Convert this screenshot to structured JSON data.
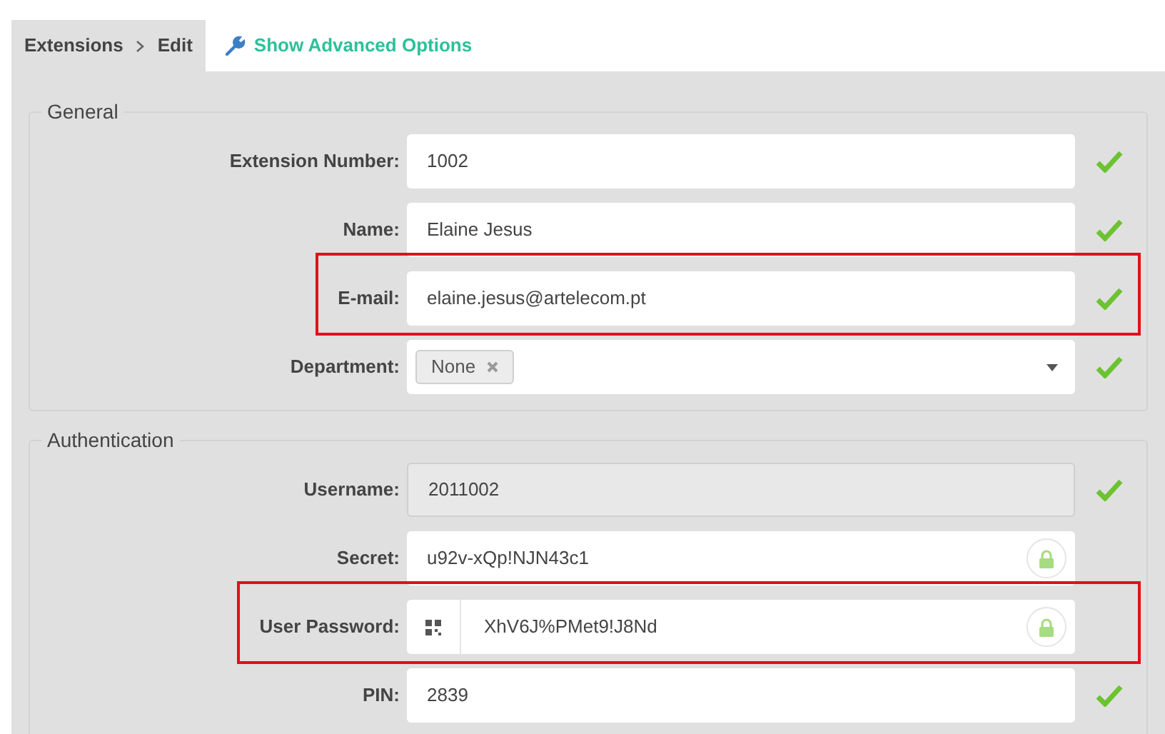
{
  "breadcrumb": {
    "items": [
      "Extensions",
      "Edit"
    ]
  },
  "advanced_link": "Show Advanced Options",
  "sections": [
    {
      "legend": "General",
      "fields": [
        {
          "label": "Extension Number:",
          "kind": "text",
          "value": "1002",
          "validated": true,
          "disabled": false,
          "highlighted": false
        },
        {
          "label": "Name:",
          "kind": "text",
          "value": "Elaine Jesus",
          "validated": true,
          "disabled": false,
          "highlighted": false
        },
        {
          "label": "E-mail:",
          "kind": "text",
          "value": "elaine.jesus@artelecom.pt",
          "validated": true,
          "disabled": false,
          "highlighted": true
        },
        {
          "label": "Department:",
          "kind": "select",
          "tag": "None",
          "validated": true,
          "disabled": false,
          "highlighted": false
        }
      ]
    },
    {
      "legend": "Authentication",
      "fields": [
        {
          "label": "Username:",
          "kind": "text",
          "value": "2011002",
          "validated": true,
          "disabled": true,
          "highlighted": false
        },
        {
          "label": "Secret:",
          "kind": "secret",
          "value": "u92v-xQp!NJN43c1",
          "validated": false,
          "disabled": false,
          "highlighted": false
        },
        {
          "label": "User Password:",
          "kind": "password",
          "value": "XhV6J%PMet9!J8Nd",
          "validated": false,
          "disabled": false,
          "highlighted": true
        },
        {
          "label": "PIN:",
          "kind": "text",
          "value": "2839",
          "validated": true,
          "disabled": false,
          "highlighted": false
        }
      ]
    }
  ]
}
